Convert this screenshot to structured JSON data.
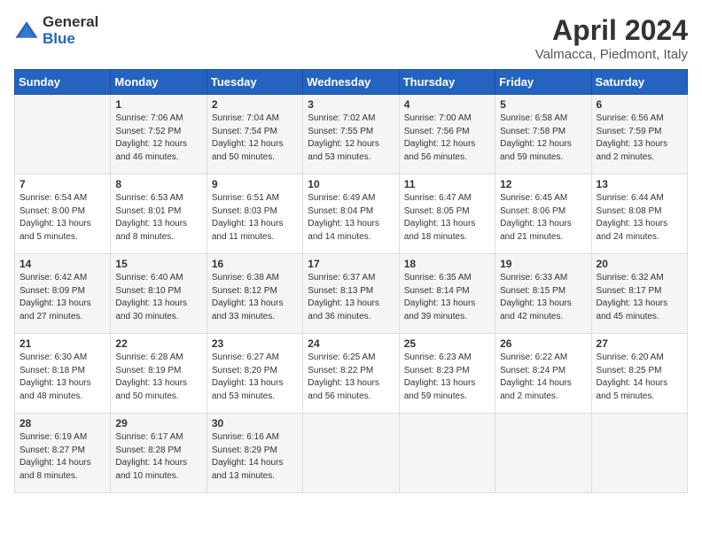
{
  "logo": {
    "general": "General",
    "blue": "Blue"
  },
  "title": "April 2024",
  "location": "Valmacca, Piedmont, Italy",
  "weekdays": [
    "Sunday",
    "Monday",
    "Tuesday",
    "Wednesday",
    "Thursday",
    "Friday",
    "Saturday"
  ],
  "weeks": [
    [
      {
        "day": "",
        "sunrise": "",
        "sunset": "",
        "daylight": ""
      },
      {
        "day": "1",
        "sunrise": "Sunrise: 7:06 AM",
        "sunset": "Sunset: 7:52 PM",
        "daylight": "Daylight: 12 hours and 46 minutes."
      },
      {
        "day": "2",
        "sunrise": "Sunrise: 7:04 AM",
        "sunset": "Sunset: 7:54 PM",
        "daylight": "Daylight: 12 hours and 50 minutes."
      },
      {
        "day": "3",
        "sunrise": "Sunrise: 7:02 AM",
        "sunset": "Sunset: 7:55 PM",
        "daylight": "Daylight: 12 hours and 53 minutes."
      },
      {
        "day": "4",
        "sunrise": "Sunrise: 7:00 AM",
        "sunset": "Sunset: 7:56 PM",
        "daylight": "Daylight: 12 hours and 56 minutes."
      },
      {
        "day": "5",
        "sunrise": "Sunrise: 6:58 AM",
        "sunset": "Sunset: 7:58 PM",
        "daylight": "Daylight: 12 hours and 59 minutes."
      },
      {
        "day": "6",
        "sunrise": "Sunrise: 6:56 AM",
        "sunset": "Sunset: 7:59 PM",
        "daylight": "Daylight: 13 hours and 2 minutes."
      }
    ],
    [
      {
        "day": "7",
        "sunrise": "Sunrise: 6:54 AM",
        "sunset": "Sunset: 8:00 PM",
        "daylight": "Daylight: 13 hours and 5 minutes."
      },
      {
        "day": "8",
        "sunrise": "Sunrise: 6:53 AM",
        "sunset": "Sunset: 8:01 PM",
        "daylight": "Daylight: 13 hours and 8 minutes."
      },
      {
        "day": "9",
        "sunrise": "Sunrise: 6:51 AM",
        "sunset": "Sunset: 8:03 PM",
        "daylight": "Daylight: 13 hours and 11 minutes."
      },
      {
        "day": "10",
        "sunrise": "Sunrise: 6:49 AM",
        "sunset": "Sunset: 8:04 PM",
        "daylight": "Daylight: 13 hours and 14 minutes."
      },
      {
        "day": "11",
        "sunrise": "Sunrise: 6:47 AM",
        "sunset": "Sunset: 8:05 PM",
        "daylight": "Daylight: 13 hours and 18 minutes."
      },
      {
        "day": "12",
        "sunrise": "Sunrise: 6:45 AM",
        "sunset": "Sunset: 8:06 PM",
        "daylight": "Daylight: 13 hours and 21 minutes."
      },
      {
        "day": "13",
        "sunrise": "Sunrise: 6:44 AM",
        "sunset": "Sunset: 8:08 PM",
        "daylight": "Daylight: 13 hours and 24 minutes."
      }
    ],
    [
      {
        "day": "14",
        "sunrise": "Sunrise: 6:42 AM",
        "sunset": "Sunset: 8:09 PM",
        "daylight": "Daylight: 13 hours and 27 minutes."
      },
      {
        "day": "15",
        "sunrise": "Sunrise: 6:40 AM",
        "sunset": "Sunset: 8:10 PM",
        "daylight": "Daylight: 13 hours and 30 minutes."
      },
      {
        "day": "16",
        "sunrise": "Sunrise: 6:38 AM",
        "sunset": "Sunset: 8:12 PM",
        "daylight": "Daylight: 13 hours and 33 minutes."
      },
      {
        "day": "17",
        "sunrise": "Sunrise: 6:37 AM",
        "sunset": "Sunset: 8:13 PM",
        "daylight": "Daylight: 13 hours and 36 minutes."
      },
      {
        "day": "18",
        "sunrise": "Sunrise: 6:35 AM",
        "sunset": "Sunset: 8:14 PM",
        "daylight": "Daylight: 13 hours and 39 minutes."
      },
      {
        "day": "19",
        "sunrise": "Sunrise: 6:33 AM",
        "sunset": "Sunset: 8:15 PM",
        "daylight": "Daylight: 13 hours and 42 minutes."
      },
      {
        "day": "20",
        "sunrise": "Sunrise: 6:32 AM",
        "sunset": "Sunset: 8:17 PM",
        "daylight": "Daylight: 13 hours and 45 minutes."
      }
    ],
    [
      {
        "day": "21",
        "sunrise": "Sunrise: 6:30 AM",
        "sunset": "Sunset: 8:18 PM",
        "daylight": "Daylight: 13 hours and 48 minutes."
      },
      {
        "day": "22",
        "sunrise": "Sunrise: 6:28 AM",
        "sunset": "Sunset: 8:19 PM",
        "daylight": "Daylight: 13 hours and 50 minutes."
      },
      {
        "day": "23",
        "sunrise": "Sunrise: 6:27 AM",
        "sunset": "Sunset: 8:20 PM",
        "daylight": "Daylight: 13 hours and 53 minutes."
      },
      {
        "day": "24",
        "sunrise": "Sunrise: 6:25 AM",
        "sunset": "Sunset: 8:22 PM",
        "daylight": "Daylight: 13 hours and 56 minutes."
      },
      {
        "day": "25",
        "sunrise": "Sunrise: 6:23 AM",
        "sunset": "Sunset: 8:23 PM",
        "daylight": "Daylight: 13 hours and 59 minutes."
      },
      {
        "day": "26",
        "sunrise": "Sunrise: 6:22 AM",
        "sunset": "Sunset: 8:24 PM",
        "daylight": "Daylight: 14 hours and 2 minutes."
      },
      {
        "day": "27",
        "sunrise": "Sunrise: 6:20 AM",
        "sunset": "Sunset: 8:25 PM",
        "daylight": "Daylight: 14 hours and 5 minutes."
      }
    ],
    [
      {
        "day": "28",
        "sunrise": "Sunrise: 6:19 AM",
        "sunset": "Sunset: 8:27 PM",
        "daylight": "Daylight: 14 hours and 8 minutes."
      },
      {
        "day": "29",
        "sunrise": "Sunrise: 6:17 AM",
        "sunset": "Sunset: 8:28 PM",
        "daylight": "Daylight: 14 hours and 10 minutes."
      },
      {
        "day": "30",
        "sunrise": "Sunrise: 6:16 AM",
        "sunset": "Sunset: 8:29 PM",
        "daylight": "Daylight: 14 hours and 13 minutes."
      },
      {
        "day": "",
        "sunrise": "",
        "sunset": "",
        "daylight": ""
      },
      {
        "day": "",
        "sunrise": "",
        "sunset": "",
        "daylight": ""
      },
      {
        "day": "",
        "sunrise": "",
        "sunset": "",
        "daylight": ""
      },
      {
        "day": "",
        "sunrise": "",
        "sunset": "",
        "daylight": ""
      }
    ]
  ]
}
